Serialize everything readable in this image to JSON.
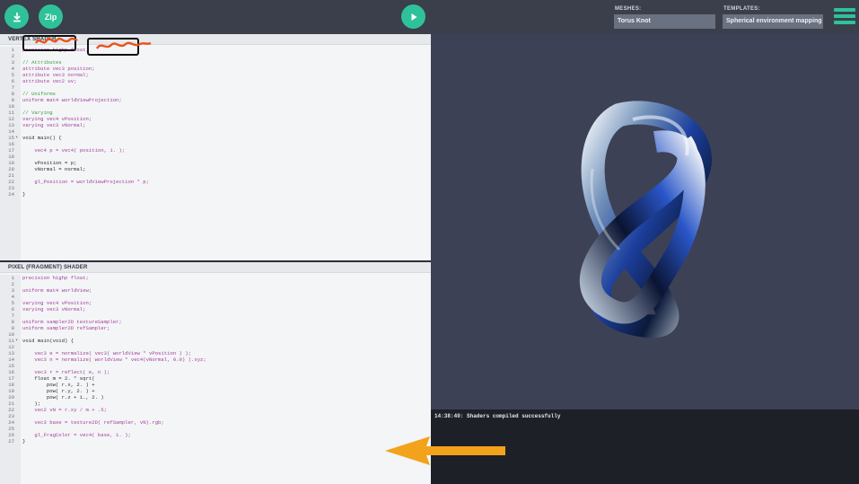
{
  "toolbar": {
    "download_icon": "download-icon",
    "zip_label": "Zip",
    "play_icon": "play-icon",
    "meshes_label": "MESHES:",
    "meshes_value": "Torus Knot",
    "templates_label": "TEMPLATES:",
    "templates_value": "Spherical environment mapping",
    "menu_icon": "hamburger-icon"
  },
  "vertex_shader": {
    "title": "VERTEX SHADER",
    "lines": [
      {
        "n": "1",
        "text": "precision highp float;",
        "kind": "keyword"
      },
      {
        "n": "2",
        "text": "",
        "kind": "normal"
      },
      {
        "n": "3",
        "text": "// Attributes",
        "kind": "comment"
      },
      {
        "n": "4",
        "text": "attribute vec3 position;",
        "kind": "keyword"
      },
      {
        "n": "5",
        "text": "attribute vec3 normal;",
        "kind": "keyword"
      },
      {
        "n": "6",
        "text": "attribute vec2 uv;",
        "kind": "keyword"
      },
      {
        "n": "7",
        "text": "",
        "kind": "normal"
      },
      {
        "n": "8",
        "text": "// Uniforms",
        "kind": "comment"
      },
      {
        "n": "9",
        "text": "uniform mat4 worldViewProjection;",
        "kind": "keyword"
      },
      {
        "n": "10",
        "text": "",
        "kind": "normal"
      },
      {
        "n": "11",
        "text": "// Varying",
        "kind": "comment"
      },
      {
        "n": "12",
        "text": "varying vec4 vPosition;",
        "kind": "keyword"
      },
      {
        "n": "13",
        "text": "varying vec3 vNormal;",
        "kind": "keyword"
      },
      {
        "n": "14",
        "text": "",
        "kind": "normal"
      },
      {
        "n": "15",
        "text": "void main() {",
        "kind": "normal",
        "fold": true
      },
      {
        "n": "16",
        "text": "",
        "kind": "normal"
      },
      {
        "n": "17",
        "text": "    vec4 p = vec4( position, 1. );",
        "kind": "keyword"
      },
      {
        "n": "18",
        "text": "",
        "kind": "normal"
      },
      {
        "n": "19",
        "text": "    vPosition = p;",
        "kind": "normal"
      },
      {
        "n": "20",
        "text": "    vNormal = normal;",
        "kind": "normal"
      },
      {
        "n": "21",
        "text": "",
        "kind": "normal"
      },
      {
        "n": "22",
        "text": "    gl_Position = worldViewProjection * p;",
        "kind": "keyword"
      },
      {
        "n": "23",
        "text": "",
        "kind": "normal"
      },
      {
        "n": "24",
        "text": "}",
        "kind": "normal"
      }
    ]
  },
  "fragment_shader": {
    "title": "PIXEL (FRAGMENT) SHADER",
    "lines": [
      {
        "n": "1",
        "text": "precision highp float;",
        "kind": "keyword"
      },
      {
        "n": "2",
        "text": "",
        "kind": "normal"
      },
      {
        "n": "3",
        "text": "uniform mat4 worldView;",
        "kind": "keyword"
      },
      {
        "n": "4",
        "text": "",
        "kind": "normal"
      },
      {
        "n": "5",
        "text": "varying vec4 vPosition;",
        "kind": "keyword"
      },
      {
        "n": "6",
        "text": "varying vec3 vNormal;",
        "kind": "keyword"
      },
      {
        "n": "7",
        "text": "",
        "kind": "normal"
      },
      {
        "n": "8",
        "text": "uniform sampler2D textureSampler;",
        "kind": "keyword"
      },
      {
        "n": "9",
        "text": "uniform sampler2D refSampler;",
        "kind": "keyword"
      },
      {
        "n": "10",
        "text": "",
        "kind": "normal"
      },
      {
        "n": "11",
        "text": "void main(void) {",
        "kind": "normal",
        "fold": true
      },
      {
        "n": "12",
        "text": "",
        "kind": "normal"
      },
      {
        "n": "13",
        "text": "    vec3 e = normalize( vec3( worldView * vPosition ) );",
        "kind": "keyword"
      },
      {
        "n": "14",
        "text": "    vec3 n = normalize( worldView * vec4(vNormal, 0.0) ).xyz;",
        "kind": "keyword"
      },
      {
        "n": "15",
        "text": "",
        "kind": "normal"
      },
      {
        "n": "16",
        "text": "    vec3 r = reflect( e, n );",
        "kind": "keyword"
      },
      {
        "n": "17",
        "text": "    float m = 2. * sqrt(",
        "kind": "normal"
      },
      {
        "n": "18",
        "text": "        pow( r.x, 2. ) +",
        "kind": "normal"
      },
      {
        "n": "19",
        "text": "        pow( r.y, 2. ) +",
        "kind": "normal"
      },
      {
        "n": "20",
        "text": "        pow( r.z + 1., 2. )",
        "kind": "normal"
      },
      {
        "n": "21",
        "text": "    );",
        "kind": "normal"
      },
      {
        "n": "22",
        "text": "    vec2 vN = r.xy / m + .5;",
        "kind": "keyword"
      },
      {
        "n": "23",
        "text": "",
        "kind": "normal"
      },
      {
        "n": "24",
        "text": "    vec3 base = texture2D( refSampler, vN).rgb;",
        "kind": "keyword"
      },
      {
        "n": "25",
        "text": "",
        "kind": "normal"
      },
      {
        "n": "26",
        "text": "    gl_FragColor = vec4( base, 1. );",
        "kind": "keyword"
      },
      {
        "n": "27",
        "text": "}",
        "kind": "normal"
      }
    ]
  },
  "console": {
    "message": "14:38:40: Shaders compiled successfully"
  },
  "colors": {
    "accent": "#2fc29a",
    "viewport_bg": "#3d4156",
    "annotation_arrow": "#f2a21b",
    "annotation_scribble": "#e8541e"
  }
}
